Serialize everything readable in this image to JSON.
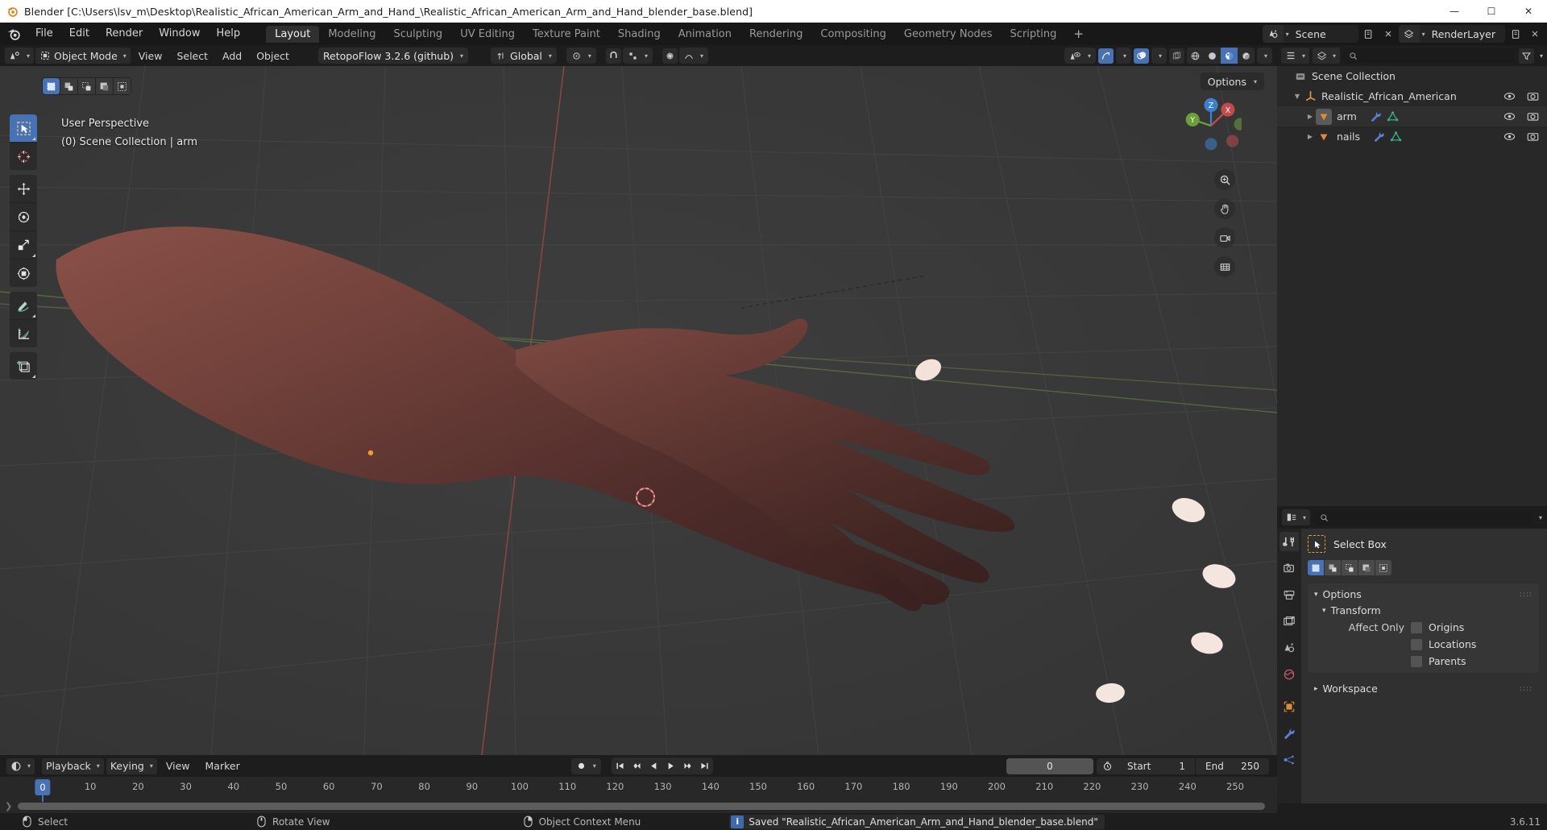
{
  "window": {
    "title": "Blender [C:\\Users\\lsv_m\\Desktop\\Realistic_African_American_Arm_and_Hand_\\Realistic_African_American_Arm_and_Hand_blender_base.blend]",
    "minimize": "—",
    "maximize": "☐",
    "close": "✕"
  },
  "topbar": {
    "menus": [
      "File",
      "Edit",
      "Render",
      "Window",
      "Help"
    ],
    "workspaces": [
      {
        "label": "Layout",
        "active": true
      },
      {
        "label": "Modeling",
        "active": false
      },
      {
        "label": "Sculpting",
        "active": false
      },
      {
        "label": "UV Editing",
        "active": false
      },
      {
        "label": "Texture Paint",
        "active": false
      },
      {
        "label": "Shading",
        "active": false
      },
      {
        "label": "Animation",
        "active": false
      },
      {
        "label": "Rendering",
        "active": false
      },
      {
        "label": "Compositing",
        "active": false
      },
      {
        "label": "Geometry Nodes",
        "active": false
      },
      {
        "label": "Scripting",
        "active": false
      }
    ],
    "add_workspace": "+",
    "scene_name": "Scene",
    "view_layer_name": "RenderLayer"
  },
  "viewport_header": {
    "editor_type": "editor-type-3d-viewport",
    "mode": "Object Mode",
    "menus": [
      "View",
      "Select",
      "Add",
      "Object"
    ],
    "addon_menu": "RetopoFlow 3.2.6 (github)",
    "transform_orientation": "Global",
    "snap": "snap-magnet",
    "proportional": "proportional-editing",
    "shading_modes": [
      "wireframe",
      "solid",
      "material-preview",
      "rendered"
    ],
    "shading_active": "material-preview"
  },
  "viewport": {
    "options_label": "Options",
    "overlay_line1": "User Perspective",
    "overlay_line2": "(0) Scene Collection | arm",
    "gizmo_axes": [
      "X",
      "Y",
      "Z"
    ],
    "toolbar_tools": [
      {
        "name": "tweak-select-box",
        "label": "Select Box",
        "active": true
      },
      {
        "name": "cursor",
        "label": "Cursor",
        "active": false
      },
      {
        "name": "move",
        "label": "Move",
        "active": false
      },
      {
        "name": "rotate",
        "label": "Rotate",
        "active": false
      },
      {
        "name": "scale",
        "label": "Scale",
        "active": false
      },
      {
        "name": "transform",
        "label": "Transform",
        "active": false
      },
      {
        "name": "annotate",
        "label": "Annotate",
        "active": false
      },
      {
        "name": "measure",
        "label": "Measure",
        "active": false
      },
      {
        "name": "add-cube",
        "label": "Add Cube",
        "active": false
      }
    ],
    "nav_buttons": [
      "zoom",
      "pan",
      "camera",
      "orthographic"
    ],
    "select_modes": [
      "set",
      "extend",
      "subtract",
      "invert",
      "intersect"
    ]
  },
  "outliner": {
    "display_mode": "View Layer",
    "search_placeholder": "",
    "filter_icon": "filter-icon",
    "rows": [
      {
        "label": "Scene Collection",
        "icon": "collection-icon",
        "indent": 0,
        "expander": "",
        "selected": false,
        "has_eye": false,
        "has_camera": false,
        "extra_icons": []
      },
      {
        "label": "Realistic_African_American",
        "icon": "empty-axis-icon",
        "indent": 1,
        "expander": "▼",
        "selected": false,
        "has_eye": true,
        "has_camera": true,
        "extra_icons": []
      },
      {
        "label": "arm",
        "icon": "mesh-object-icon",
        "indent": 2,
        "expander": "▶",
        "selected": true,
        "has_eye": true,
        "has_camera": true,
        "extra_icons": [
          "modifier-wrench-icon",
          "mesh-data-icon"
        ]
      },
      {
        "label": "nails",
        "icon": "mesh-object-icon",
        "indent": 2,
        "expander": "▶",
        "selected": false,
        "has_eye": true,
        "has_camera": true,
        "extra_icons": [
          "modifier-wrench-icon",
          "mesh-data-icon"
        ]
      }
    ]
  },
  "properties": {
    "search_placeholder": "",
    "tabs": [
      {
        "name": "tool",
        "active": true
      },
      {
        "name": "render",
        "active": false
      },
      {
        "name": "output",
        "active": false
      },
      {
        "name": "view-layer",
        "active": false
      },
      {
        "name": "scene",
        "active": false
      },
      {
        "name": "world",
        "active": false
      },
      {
        "name": "object",
        "active": false
      },
      {
        "name": "modifiers",
        "active": false
      },
      {
        "name": "particles",
        "active": false
      }
    ],
    "active_tool_label": "Select Box",
    "panels": [
      {
        "label": "Options",
        "open": true,
        "grip": "::::"
      },
      {
        "label": "Transform",
        "open": true,
        "sub": true
      },
      {
        "label": "Workspace",
        "open": false,
        "grip": "::::"
      }
    ],
    "affect_only_label": "Affect Only",
    "affect_only_options": [
      {
        "label": "Origins",
        "checked": false
      },
      {
        "label": "Locations",
        "checked": false
      },
      {
        "label": "Parents",
        "checked": false
      }
    ]
  },
  "timeline": {
    "editor_type": "editor-type-timeline",
    "menus": [
      "Playback",
      "Keying",
      "View",
      "Marker"
    ],
    "record_icon": "record-icon",
    "transport": [
      "jump-to-start",
      "prev-keyframe",
      "play-reverse",
      "play",
      "next-keyframe",
      "jump-to-end"
    ],
    "current_frame": "0",
    "start_label": "Start",
    "start_value": "1",
    "end_label": "End",
    "end_value": "250",
    "ticks": [
      "0",
      "10",
      "20",
      "30",
      "40",
      "50",
      "60",
      "70",
      "80",
      "90",
      "100",
      "110",
      "120",
      "130",
      "140",
      "150",
      "160",
      "170",
      "180",
      "190",
      "200",
      "210",
      "220",
      "230",
      "240",
      "250"
    ],
    "playhead_frame": "0"
  },
  "statusbar": {
    "hints": [
      {
        "icon": "mouse-left-icon",
        "label": "Select"
      },
      {
        "icon": "mouse-middle-icon",
        "label": "Rotate View"
      },
      {
        "icon": "mouse-right-icon",
        "label": "Object Context Menu"
      }
    ],
    "message": "Saved \"Realistic_African_American_Arm_and_Hand_blender_base.blend\"",
    "version": "3.6.11"
  },
  "colors": {
    "accent_blue": "#4772b3",
    "orange": "#e0a12c",
    "axis_red": "#b34d4d",
    "axis_green": "#7da64d",
    "header_bg": "#1d1d1d",
    "panel_bg": "#303030",
    "outliner_bg": "#282828"
  }
}
